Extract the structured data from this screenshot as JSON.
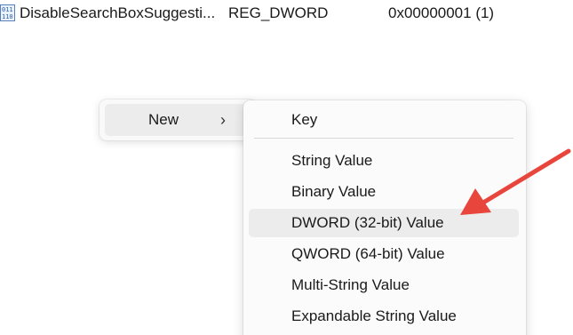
{
  "registry_row": {
    "icon": "reg-binary-value-icon",
    "name": "DisableSearchBoxSuggesti...",
    "type": "REG_DWORD",
    "data": "0x00000001 (1)"
  },
  "context_menu": {
    "new_label": "New",
    "chevron": "›"
  },
  "submenu": {
    "items": [
      "Key",
      "String Value",
      "Binary Value",
      "DWORD (32-bit) Value",
      "QWORD (64-bit) Value",
      "Multi-String Value",
      "Expandable String Value"
    ],
    "hovered": "DWORD (32-bit) Value"
  },
  "annotation": {
    "arrow_color": "#e8453c"
  }
}
